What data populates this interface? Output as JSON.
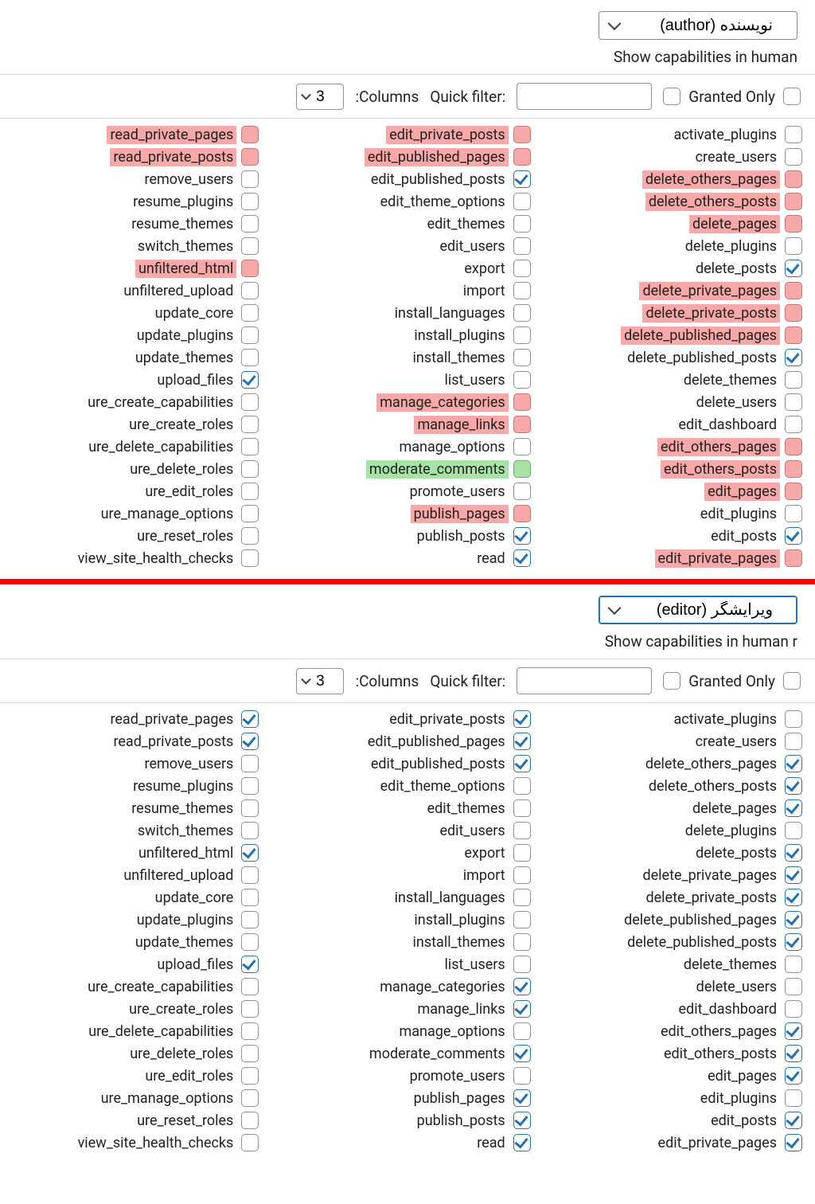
{
  "common": {
    "human_label": "Show capabilities in human",
    "columns_label": ":Columns",
    "quick_filter_label": "Quick filter:",
    "granted_only_label": "Granted Only",
    "columns_value": "3"
  },
  "sections": [
    {
      "id": "author",
      "role_label": "نویسنده (author)",
      "focused": false,
      "human_label_suffix": "",
      "columns": [
        [
          {
            "label": "activate_plugins",
            "checked": false,
            "hl": ""
          },
          {
            "label": "create_users",
            "checked": false,
            "hl": ""
          },
          {
            "label": "delete_others_pages",
            "checked": false,
            "hl": "red"
          },
          {
            "label": "delete_others_posts",
            "checked": false,
            "hl": "red"
          },
          {
            "label": "delete_pages",
            "checked": false,
            "hl": "red"
          },
          {
            "label": "delete_plugins",
            "checked": false,
            "hl": ""
          },
          {
            "label": "delete_posts",
            "checked": true,
            "hl": ""
          },
          {
            "label": "delete_private_pages",
            "checked": false,
            "hl": "red"
          },
          {
            "label": "delete_private_posts",
            "checked": false,
            "hl": "red"
          },
          {
            "label": "delete_published_pages",
            "checked": false,
            "hl": "red"
          },
          {
            "label": "delete_published_posts",
            "checked": true,
            "hl": ""
          },
          {
            "label": "delete_themes",
            "checked": false,
            "hl": ""
          },
          {
            "label": "delete_users",
            "checked": false,
            "hl": ""
          },
          {
            "label": "edit_dashboard",
            "checked": false,
            "hl": ""
          },
          {
            "label": "edit_others_pages",
            "checked": false,
            "hl": "red"
          },
          {
            "label": "edit_others_posts",
            "checked": false,
            "hl": "red"
          },
          {
            "label": "edit_pages",
            "checked": false,
            "hl": "red"
          },
          {
            "label": "edit_plugins",
            "checked": false,
            "hl": ""
          },
          {
            "label": "edit_posts",
            "checked": true,
            "hl": ""
          },
          {
            "label": "edit_private_pages",
            "checked": false,
            "hl": "red"
          }
        ],
        [
          {
            "label": "edit_private_posts",
            "checked": false,
            "hl": "red"
          },
          {
            "label": "edit_published_pages",
            "checked": false,
            "hl": "red"
          },
          {
            "label": "edit_published_posts",
            "checked": true,
            "hl": ""
          },
          {
            "label": "edit_theme_options",
            "checked": false,
            "hl": ""
          },
          {
            "label": "edit_themes",
            "checked": false,
            "hl": ""
          },
          {
            "label": "edit_users",
            "checked": false,
            "hl": ""
          },
          {
            "label": "export",
            "checked": false,
            "hl": ""
          },
          {
            "label": "import",
            "checked": false,
            "hl": ""
          },
          {
            "label": "install_languages",
            "checked": false,
            "hl": ""
          },
          {
            "label": "install_plugins",
            "checked": false,
            "hl": ""
          },
          {
            "label": "install_themes",
            "checked": false,
            "hl": ""
          },
          {
            "label": "list_users",
            "checked": false,
            "hl": ""
          },
          {
            "label": "manage_categories",
            "checked": false,
            "hl": "red"
          },
          {
            "label": "manage_links",
            "checked": false,
            "hl": "red"
          },
          {
            "label": "manage_options",
            "checked": false,
            "hl": ""
          },
          {
            "label": "moderate_comments",
            "checked": false,
            "hl": "green"
          },
          {
            "label": "promote_users",
            "checked": false,
            "hl": ""
          },
          {
            "label": "publish_pages",
            "checked": false,
            "hl": "red"
          },
          {
            "label": "publish_posts",
            "checked": true,
            "hl": ""
          },
          {
            "label": "read",
            "checked": true,
            "hl": ""
          }
        ],
        [
          {
            "label": "read_private_pages",
            "checked": false,
            "hl": "red"
          },
          {
            "label": "read_private_posts",
            "checked": false,
            "hl": "red"
          },
          {
            "label": "remove_users",
            "checked": false,
            "hl": ""
          },
          {
            "label": "resume_plugins",
            "checked": false,
            "hl": ""
          },
          {
            "label": "resume_themes",
            "checked": false,
            "hl": ""
          },
          {
            "label": "switch_themes",
            "checked": false,
            "hl": ""
          },
          {
            "label": "unfiltered_html",
            "checked": false,
            "hl": "red"
          },
          {
            "label": "unfiltered_upload",
            "checked": false,
            "hl": ""
          },
          {
            "label": "update_core",
            "checked": false,
            "hl": ""
          },
          {
            "label": "update_plugins",
            "checked": false,
            "hl": ""
          },
          {
            "label": "update_themes",
            "checked": false,
            "hl": ""
          },
          {
            "label": "upload_files",
            "checked": true,
            "hl": ""
          },
          {
            "label": "ure_create_capabilities",
            "checked": false,
            "hl": ""
          },
          {
            "label": "ure_create_roles",
            "checked": false,
            "hl": ""
          },
          {
            "label": "ure_delete_capabilities",
            "checked": false,
            "hl": ""
          },
          {
            "label": "ure_delete_roles",
            "checked": false,
            "hl": ""
          },
          {
            "label": "ure_edit_roles",
            "checked": false,
            "hl": ""
          },
          {
            "label": "ure_manage_options",
            "checked": false,
            "hl": ""
          },
          {
            "label": "ure_reset_roles",
            "checked": false,
            "hl": ""
          },
          {
            "label": "view_site_health_checks",
            "checked": false,
            "hl": ""
          }
        ]
      ]
    },
    {
      "id": "editor",
      "role_label": "ویرایشگر (editor)",
      "focused": true,
      "human_label_suffix": " r",
      "columns": [
        [
          {
            "label": "activate_plugins",
            "checked": false,
            "hl": ""
          },
          {
            "label": "create_users",
            "checked": false,
            "hl": ""
          },
          {
            "label": "delete_others_pages",
            "checked": true,
            "hl": ""
          },
          {
            "label": "delete_others_posts",
            "checked": true,
            "hl": ""
          },
          {
            "label": "delete_pages",
            "checked": true,
            "hl": ""
          },
          {
            "label": "delete_plugins",
            "checked": false,
            "hl": ""
          },
          {
            "label": "delete_posts",
            "checked": true,
            "hl": ""
          },
          {
            "label": "delete_private_pages",
            "checked": true,
            "hl": ""
          },
          {
            "label": "delete_private_posts",
            "checked": true,
            "hl": ""
          },
          {
            "label": "delete_published_pages",
            "checked": true,
            "hl": ""
          },
          {
            "label": "delete_published_posts",
            "checked": true,
            "hl": ""
          },
          {
            "label": "delete_themes",
            "checked": false,
            "hl": ""
          },
          {
            "label": "delete_users",
            "checked": false,
            "hl": ""
          },
          {
            "label": "edit_dashboard",
            "checked": false,
            "hl": ""
          },
          {
            "label": "edit_others_pages",
            "checked": true,
            "hl": ""
          },
          {
            "label": "edit_others_posts",
            "checked": true,
            "hl": ""
          },
          {
            "label": "edit_pages",
            "checked": true,
            "hl": ""
          },
          {
            "label": "edit_plugins",
            "checked": false,
            "hl": ""
          },
          {
            "label": "edit_posts",
            "checked": true,
            "hl": ""
          },
          {
            "label": "edit_private_pages",
            "checked": true,
            "hl": ""
          }
        ],
        [
          {
            "label": "edit_private_posts",
            "checked": true,
            "hl": ""
          },
          {
            "label": "edit_published_pages",
            "checked": true,
            "hl": ""
          },
          {
            "label": "edit_published_posts",
            "checked": true,
            "hl": ""
          },
          {
            "label": "edit_theme_options",
            "checked": false,
            "hl": ""
          },
          {
            "label": "edit_themes",
            "checked": false,
            "hl": ""
          },
          {
            "label": "edit_users",
            "checked": false,
            "hl": ""
          },
          {
            "label": "export",
            "checked": false,
            "hl": ""
          },
          {
            "label": "import",
            "checked": false,
            "hl": ""
          },
          {
            "label": "install_languages",
            "checked": false,
            "hl": ""
          },
          {
            "label": "install_plugins",
            "checked": false,
            "hl": ""
          },
          {
            "label": "install_themes",
            "checked": false,
            "hl": ""
          },
          {
            "label": "list_users",
            "checked": false,
            "hl": ""
          },
          {
            "label": "manage_categories",
            "checked": true,
            "hl": ""
          },
          {
            "label": "manage_links",
            "checked": true,
            "hl": ""
          },
          {
            "label": "manage_options",
            "checked": false,
            "hl": ""
          },
          {
            "label": "moderate_comments",
            "checked": true,
            "hl": ""
          },
          {
            "label": "promote_users",
            "checked": false,
            "hl": ""
          },
          {
            "label": "publish_pages",
            "checked": true,
            "hl": ""
          },
          {
            "label": "publish_posts",
            "checked": true,
            "hl": ""
          },
          {
            "label": "read",
            "checked": true,
            "hl": ""
          }
        ],
        [
          {
            "label": "read_private_pages",
            "checked": true,
            "hl": ""
          },
          {
            "label": "read_private_posts",
            "checked": true,
            "hl": ""
          },
          {
            "label": "remove_users",
            "checked": false,
            "hl": ""
          },
          {
            "label": "resume_plugins",
            "checked": false,
            "hl": ""
          },
          {
            "label": "resume_themes",
            "checked": false,
            "hl": ""
          },
          {
            "label": "switch_themes",
            "checked": false,
            "hl": ""
          },
          {
            "label": "unfiltered_html",
            "checked": true,
            "hl": ""
          },
          {
            "label": "unfiltered_upload",
            "checked": false,
            "hl": ""
          },
          {
            "label": "update_core",
            "checked": false,
            "hl": ""
          },
          {
            "label": "update_plugins",
            "checked": false,
            "hl": ""
          },
          {
            "label": "update_themes",
            "checked": false,
            "hl": ""
          },
          {
            "label": "upload_files",
            "checked": true,
            "hl": ""
          },
          {
            "label": "ure_create_capabilities",
            "checked": false,
            "hl": ""
          },
          {
            "label": "ure_create_roles",
            "checked": false,
            "hl": ""
          },
          {
            "label": "ure_delete_capabilities",
            "checked": false,
            "hl": ""
          },
          {
            "label": "ure_delete_roles",
            "checked": false,
            "hl": ""
          },
          {
            "label": "ure_edit_roles",
            "checked": false,
            "hl": ""
          },
          {
            "label": "ure_manage_options",
            "checked": false,
            "hl": ""
          },
          {
            "label": "ure_reset_roles",
            "checked": false,
            "hl": ""
          },
          {
            "label": "view_site_health_checks",
            "checked": false,
            "hl": ""
          }
        ]
      ]
    }
  ]
}
